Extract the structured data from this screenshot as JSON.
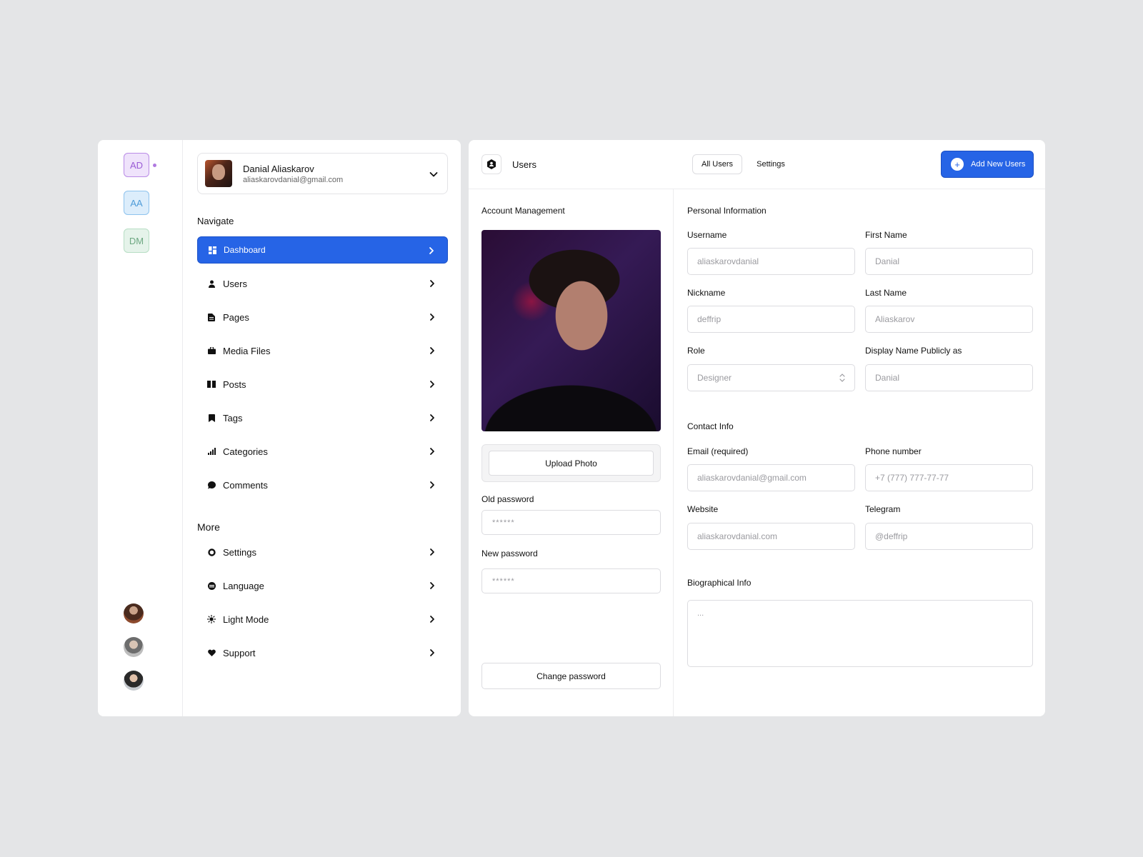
{
  "workspaces": [
    {
      "initials": "AD",
      "color": "#9a5cd6"
    },
    {
      "initials": "AA",
      "color": "#4d9bd8"
    },
    {
      "initials": "DM",
      "color": "#6ea882"
    }
  ],
  "profile": {
    "name": "Danial Aliaskarov",
    "email": "aliaskarovdanial@gmail.com"
  },
  "nav": {
    "title": "Navigate",
    "items": [
      {
        "label": "Dashboard",
        "icon": "dashboard-icon",
        "active": true
      },
      {
        "label": "Users",
        "icon": "user-icon"
      },
      {
        "label": "Pages",
        "icon": "page-icon"
      },
      {
        "label": "Media Files",
        "icon": "briefcase-icon"
      },
      {
        "label": "Posts",
        "icon": "book-icon"
      },
      {
        "label": "Tags",
        "icon": "bookmark-icon"
      },
      {
        "label": "Categories",
        "icon": "bar-chart-icon"
      },
      {
        "label": "Comments",
        "icon": "chat-bubble-icon"
      }
    ]
  },
  "more": {
    "title": "More",
    "items": [
      {
        "label": "Settings",
        "icon": "gear-icon"
      },
      {
        "label": "Language",
        "icon": "globe-icon"
      },
      {
        "label": "Light Mode",
        "icon": "sun-icon"
      },
      {
        "label": "Support",
        "icon": "heart-icon"
      }
    ]
  },
  "header": {
    "title": "Users",
    "tabs": [
      "All Users",
      "Settings"
    ],
    "add_button": "Add New Users",
    "accent": "#2664e6"
  },
  "account": {
    "title": "Account Management",
    "upload_label": "Upload Photo",
    "old_password_label": "Old password",
    "old_password_value": "******",
    "new_password_label": "New password",
    "new_password_value": "******",
    "change_password_label": "Change password"
  },
  "personal": {
    "title": "Personal Information",
    "username_label": "Username",
    "username_value": "aliaskarovdanial",
    "first_name_label": "First Name",
    "first_name_value": "Danial",
    "nickname_label": "Nickname",
    "nickname_value": "deffrip",
    "last_name_label": "Last Name",
    "last_name_value": "Aliaskarov",
    "role_label": "Role",
    "role_value": "Designer",
    "display_name_label": "Display Name Publicly as",
    "display_name_value": "Danial"
  },
  "contact": {
    "title": "Contact Info",
    "email_label": "Email (required)",
    "email_value": "aliaskarovdanial@gmail.com",
    "phone_label": "Phone number",
    "phone_value": "+7 (777) 777-77-77",
    "website_label": "Website",
    "website_value": "aliaskarovdanial.com",
    "telegram_label": "Telegram",
    "telegram_value": "@deffrip"
  },
  "bio": {
    "title": "Biographical Info",
    "placeholder": "..."
  }
}
